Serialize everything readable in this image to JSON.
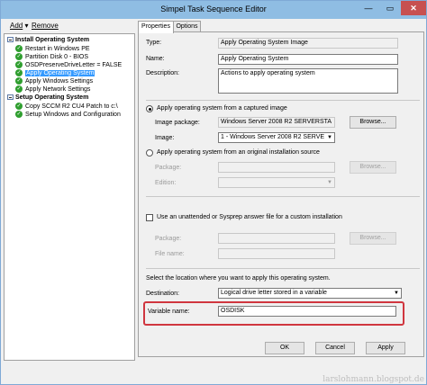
{
  "window": {
    "title": "Simpel Task Sequence Editor",
    "minimize_glyph": "—",
    "maximize_glyph": "▭",
    "close_glyph": "✕"
  },
  "menu": {
    "add_label": "Add",
    "remove_label": "Remove"
  },
  "tree": {
    "groups": [
      {
        "label": "Install Operating System",
        "steps": [
          "Restart in Windows PE",
          "Partition Disk 0 - BIOS",
          "OSDPreserveDriveLetter = FALSE",
          "Apply Operating System",
          "Apply Windows Settings",
          "Apply Network Settings"
        ]
      },
      {
        "label": "Setup Operating System",
        "steps": [
          "Copy SCCM R2 CU4 Patch to c:\\",
          "Setup Windows and Configuration"
        ]
      }
    ],
    "selected_step": "Apply Operating System"
  },
  "tabs": [
    "Properties",
    "Options"
  ],
  "properties": {
    "type_label": "Type:",
    "type_value": "Apply Operating System Image",
    "name_label": "Name:",
    "name_value": "Apply Operating System",
    "description_label": "Description:",
    "description_value": "Actions to apply operating system",
    "radio_captured_label": "Apply operating system from a captured image",
    "image_package_label": "Image package:",
    "image_package_value": "Windows Server 2008 R2 SERVERSTA",
    "browse_label": "Browse...",
    "image_label": "Image:",
    "image_value": "1 - Windows Server 2008 R2 SERVE",
    "radio_original_label": "Apply operating system from an original installation source",
    "package_label": "Package:",
    "edition_label": "Edition:",
    "unattend_label": "Use an unattended or Sysprep answer file for a custom installation",
    "package2_label": "Package:",
    "filename_label": "File name:",
    "location_text": "Select the location where you want to apply this operating system.",
    "destination_label": "Destination:",
    "destination_value": "Logical drive letter stored in a variable",
    "variable_label": "Variable name:",
    "variable_value": "OSDISK"
  },
  "buttons": {
    "ok_label": "OK",
    "cancel_label": "Cancel",
    "apply_label": "Apply"
  },
  "watermark": "larslohmann.blogspot.de",
  "colors": {
    "titlebar": "#8fbde3",
    "close_button": "#c75050",
    "selection": "#3399ff",
    "highlight_box": "#d0363f",
    "check_icon": "#2f9e2f"
  }
}
